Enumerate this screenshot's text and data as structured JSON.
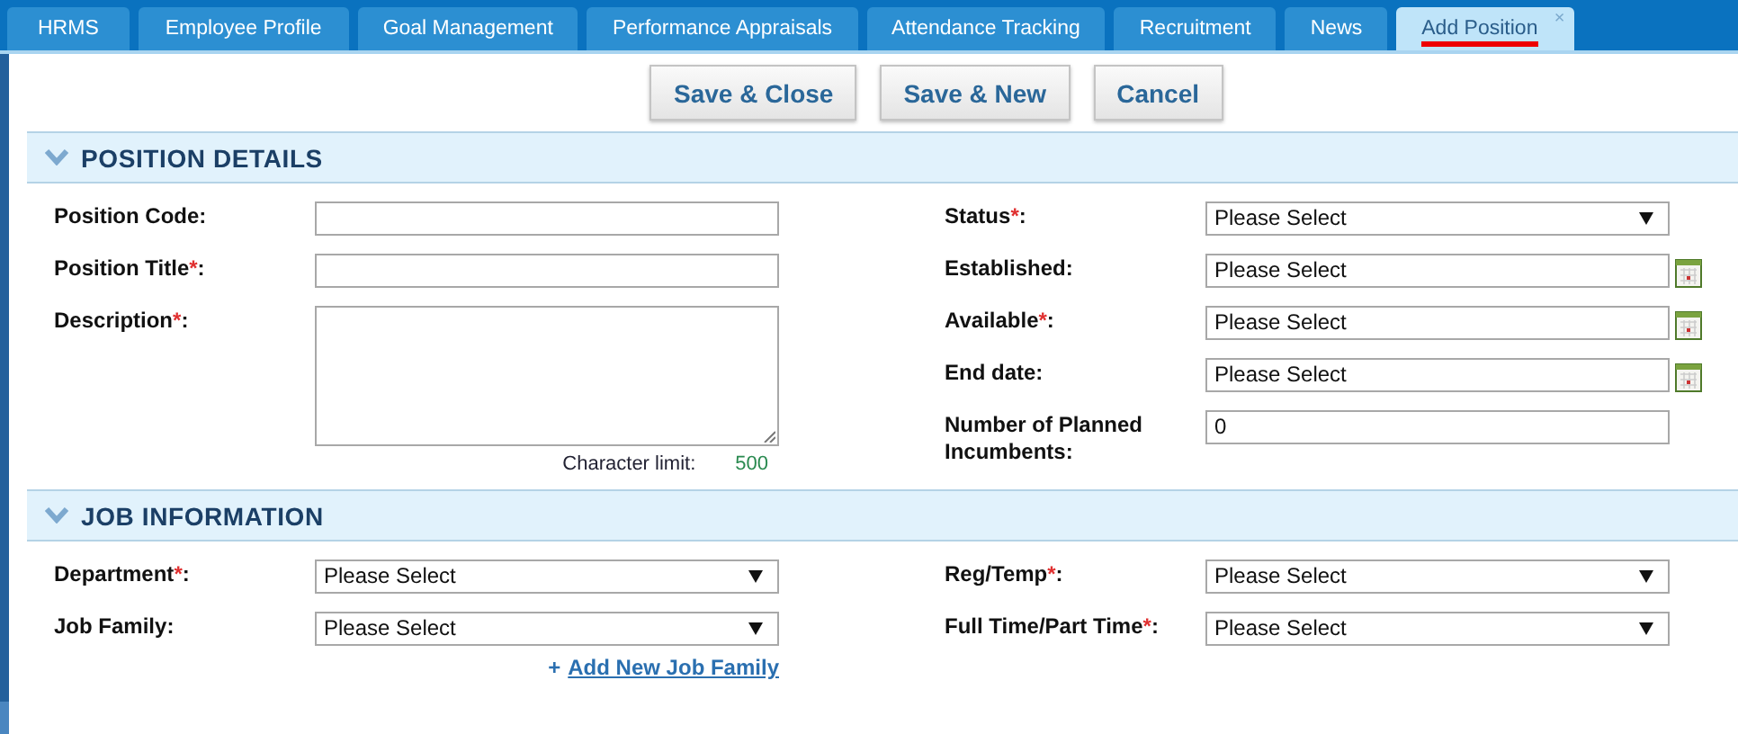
{
  "tabs": [
    {
      "label": "HRMS",
      "selected": false
    },
    {
      "label": "Employee Profile",
      "selected": false
    },
    {
      "label": "Goal Management",
      "selected": false
    },
    {
      "label": "Performance Appraisals",
      "selected": false
    },
    {
      "label": "Attendance Tracking",
      "selected": false
    },
    {
      "label": "Recruitment",
      "selected": false
    },
    {
      "label": "News",
      "selected": false
    },
    {
      "label": "Add Position",
      "selected": true,
      "close": "×"
    }
  ],
  "buttons": [
    "Save & Close",
    "Save & New",
    "Cancel"
  ],
  "sections": [
    {
      "title": "POSITION DETAILS",
      "expanded": true,
      "left": [
        {
          "kind": "text",
          "label": "Position Code",
          "colon": ":"
        },
        {
          "kind": "text",
          "label": "Position Title",
          "asterisk": "*",
          "colon": ":"
        },
        {
          "kind": "textarea",
          "label": "Description",
          "asterisk": "*",
          "colon": ":",
          "limit_label": "Character limit:",
          "limit_value": "500"
        }
      ],
      "right": [
        {
          "kind": "select",
          "label": "Status",
          "asterisk": "*",
          "colon": ":",
          "value": "Please Select"
        },
        {
          "kind": "date",
          "label": "Established",
          "colon": ":",
          "value": "Please Select"
        },
        {
          "kind": "date",
          "label": "Available",
          "asterisk": "*",
          "colon": ":",
          "value": "Please Select"
        },
        {
          "kind": "date",
          "label": "End date",
          "colon": ":",
          "value": "Please Select"
        },
        {
          "kind": "text",
          "label": "Number of Planned Incumbents",
          "colon": ":",
          "value": "0"
        }
      ]
    },
    {
      "title": "JOB INFORMATION",
      "expanded": true,
      "left": [
        {
          "kind": "select",
          "label": "Department",
          "asterisk": "*",
          "colon": ":",
          "value": "Please Select"
        },
        {
          "kind": "select",
          "label": "Job Family",
          "colon": ":",
          "value": "Please Select",
          "link_plus": "+",
          "link": "Add New Job Family"
        }
      ],
      "right": [
        {
          "kind": "select",
          "label": "Reg/Temp",
          "asterisk": "*",
          "colon": ":",
          "value": "Please Select"
        },
        {
          "kind": "select",
          "label": "Full Time/Part Time",
          "asterisk": "*",
          "colon": ":",
          "value": "Please Select"
        }
      ]
    }
  ]
}
